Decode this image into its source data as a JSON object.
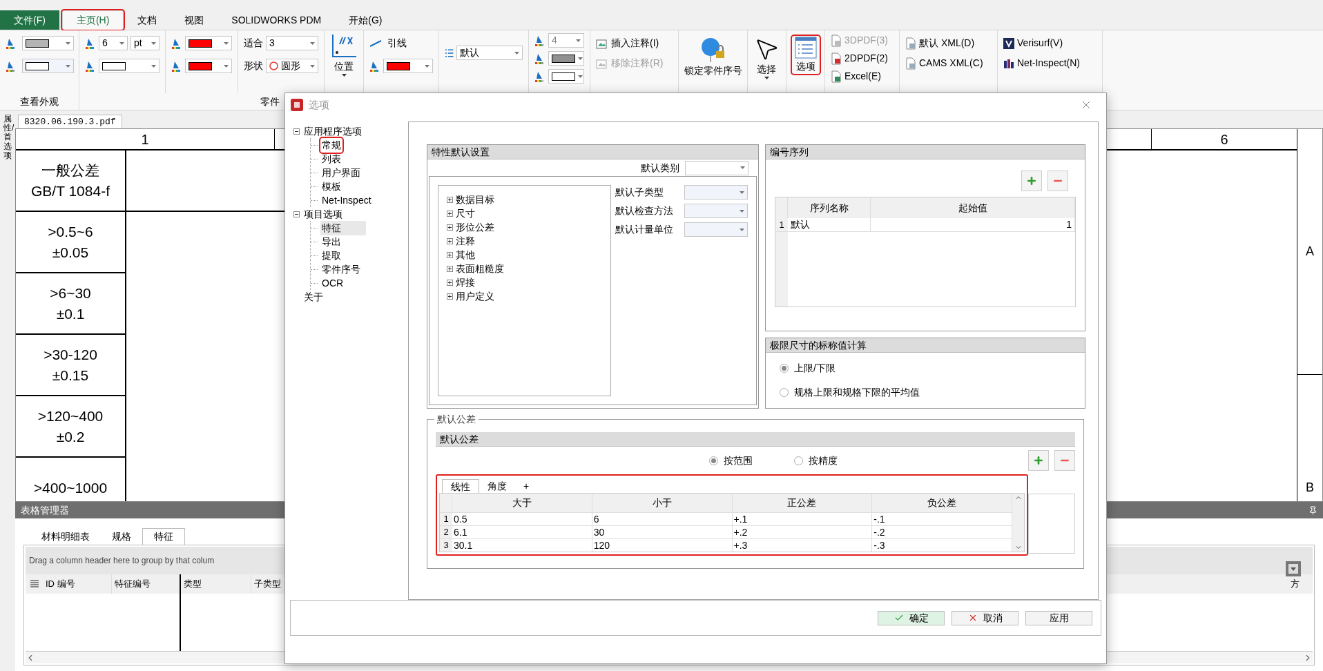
{
  "ribbon_tabs": [
    {
      "label": "文件(F)",
      "kind": "file",
      "selected": false,
      "annotated": false
    },
    {
      "label": "主页(H)",
      "kind": "tab",
      "selected": true,
      "annotated": true
    },
    {
      "label": "文档",
      "kind": "tab",
      "selected": false,
      "annotated": false
    },
    {
      "label": "视图",
      "kind": "tab",
      "selected": false,
      "annotated": false
    },
    {
      "label": "SOLIDWORKS PDM",
      "kind": "tab",
      "selected": false,
      "annotated": false
    },
    {
      "label": "开始(G)",
      "kind": "tab",
      "selected": false,
      "annotated": false
    }
  ],
  "ribbon": {
    "appearance": {
      "label": "查看外观"
    },
    "swatches": [
      {
        "color": "#b4b4b4"
      },
      {
        "color": "#ffffff"
      },
      {
        "color": "#ffffff"
      },
      {
        "color": "#ff0000"
      },
      {
        "color": "#ff0000"
      },
      {
        "color": "#ff0000"
      },
      {
        "color": "#909090"
      },
      {
        "color": "#ffffff"
      }
    ],
    "balloon": {
      "label": "零件",
      "font_size": "6",
      "unit": "pt",
      "fit_label": "适合",
      "fit_value": "3",
      "shape_label": "形状",
      "shape_value": "圆形",
      "position": "位置",
      "leader": "引线",
      "list_value": "默认",
      "size_value": "4"
    },
    "notes": [
      {
        "label": "插入注释(I)",
        "disabled": false
      },
      {
        "label": "移除注释(R)",
        "disabled": true
      }
    ],
    "lock": "锁定零件序号",
    "select": "选择",
    "options": {
      "label": "选项",
      "annotated": true
    },
    "exports": [
      {
        "label": "3DPDF(3)",
        "disabled": true
      },
      {
        "label": "2DPDF(2)",
        "disabled": false
      },
      {
        "label": "Excel(E)",
        "disabled": false
      }
    ],
    "xml": [
      "默认 XML(D)",
      "CAMS XML(C)"
    ],
    "links": [
      "Verisurf(V)",
      "Net-Inspect(N)"
    ]
  },
  "side_tab": "属性/首选项",
  "document": {
    "tab": "8320.06.190.3.pdf",
    "column_labels": [
      "1",
      "6"
    ],
    "row_labels": [
      "A",
      "B"
    ],
    "tolerance_cells": [
      {
        "lines": [
          "一般公差",
          "GB/T 1084-f"
        ]
      },
      {
        "lines": [
          ">0.5~6",
          "±0.05"
        ]
      },
      {
        "lines": [
          ">6~30",
          "±0.1"
        ]
      },
      {
        "lines": [
          ">30-120",
          "±0.15"
        ]
      },
      {
        "lines": [
          ">120~400",
          "±0.2"
        ]
      },
      {
        "lines": [
          ">400~1000"
        ]
      }
    ]
  },
  "table_manager": {
    "title": "表格管理器",
    "tabs": [
      {
        "label": "材料明细表",
        "selected": false
      },
      {
        "label": "规格",
        "selected": false
      },
      {
        "label": "特征",
        "selected": true
      }
    ],
    "group_hint": "Drag a column header here to group by that colum",
    "columns": [
      "ID 编号",
      "特征编号",
      "类型",
      "子类型"
    ],
    "last_column": "方"
  },
  "dialog": {
    "title": "选项",
    "tree": [
      {
        "label": "应用程序选项",
        "expanded": true,
        "selected": false,
        "annotated": false,
        "children": [
          {
            "label": "常规",
            "selected": false,
            "annotated": true
          },
          {
            "label": "列表",
            "selected": false,
            "annotated": false
          },
          {
            "label": "用户界面",
            "selected": false,
            "annotated": false
          },
          {
            "label": "模板",
            "selected": false,
            "annotated": false
          },
          {
            "label": "Net-Inspect",
            "selected": false,
            "annotated": false
          }
        ]
      },
      {
        "label": "项目选项",
        "expanded": true,
        "selected": false,
        "annotated": false,
        "children": [
          {
            "label": "特征",
            "selected": true,
            "annotated": false
          },
          {
            "label": "导出",
            "selected": false,
            "annotated": false
          },
          {
            "label": "提取",
            "selected": false,
            "annotated": false
          },
          {
            "label": "零件序号",
            "selected": false,
            "annotated": false
          },
          {
            "label": "OCR",
            "selected": false,
            "annotated": false
          }
        ]
      },
      {
        "label": "关于",
        "selected": false,
        "annotated": false
      }
    ],
    "feature_defaults": {
      "title": "特性默认设置",
      "category_label": "默认类别",
      "tree": [
        {
          "label": "数据目标",
          "expanded": false
        },
        {
          "label": "尺寸",
          "expanded": false
        },
        {
          "label": "形位公差",
          "expanded": false
        },
        {
          "label": "注释",
          "expanded": false
        },
        {
          "label": "其他",
          "expanded": false
        },
        {
          "label": "表面粗糙度",
          "expanded": false
        },
        {
          "label": "焊接",
          "expanded": false
        },
        {
          "label": "用户定义",
          "expanded": false
        }
      ],
      "fields": [
        "默认子类型",
        "默认检查方法",
        "默认计量单位"
      ]
    },
    "sequence": {
      "title": "编号序列",
      "columns": [
        "序列名称",
        "起始值"
      ],
      "rows": [
        {
          "index": "1",
          "cells": [
            "默认",
            "1"
          ]
        }
      ]
    },
    "limit_calc": {
      "title": "极限尺寸的标称值计算",
      "options": [
        {
          "label": "上限/下限",
          "selected": true
        },
        {
          "label": "规格上限和规格下限的平均值",
          "selected": false
        }
      ]
    },
    "tolerance": {
      "legend": "默认公差",
      "title": "默认公差",
      "annotated": true,
      "modes": [
        {
          "label": "按范围",
          "selected": true
        },
        {
          "label": "按精度",
          "selected": false
        }
      ],
      "tabs": [
        {
          "label": "线性",
          "selected": true
        },
        {
          "label": "角度",
          "selected": false
        }
      ],
      "add_tab": "+",
      "columns": [
        "大于",
        "小于",
        "正公差",
        "负公差"
      ],
      "rows": [
        {
          "index": "1",
          "cells": [
            "0.5",
            "6",
            "+.1",
            "-.1"
          ]
        },
        {
          "index": "2",
          "cells": [
            "6.1",
            "30",
            "+.2",
            "-.2"
          ]
        },
        {
          "index": "3",
          "cells": [
            "30.1",
            "120",
            "+.3",
            "-.3"
          ]
        }
      ]
    },
    "buttons": [
      {
        "label": "确定",
        "kind": "ok"
      },
      {
        "label": "取消",
        "kind": "cancel"
      },
      {
        "label": "应用",
        "kind": "apply"
      }
    ]
  }
}
